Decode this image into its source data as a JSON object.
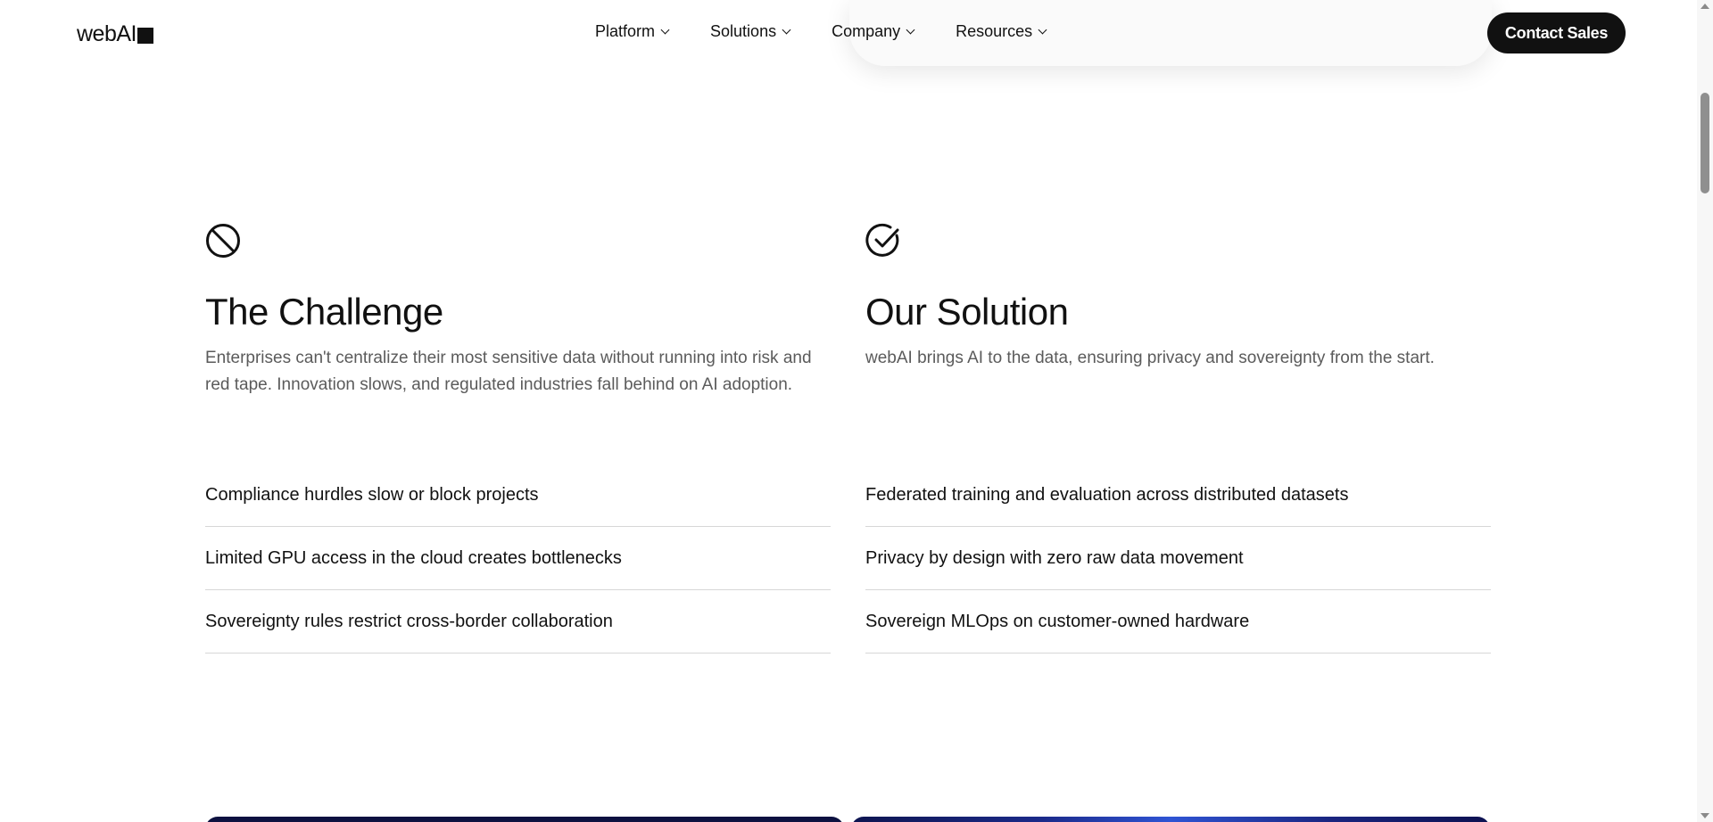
{
  "header": {
    "logo_text": "webAI",
    "nav": [
      {
        "label": "Platform"
      },
      {
        "label": "Solutions"
      },
      {
        "label": "Company"
      },
      {
        "label": "Resources"
      }
    ],
    "cta_label": "Contact Sales"
  },
  "challenge": {
    "icon": "prohibited-icon",
    "title": "The Challenge",
    "description": "Enterprises can't centralize their most sensitive data without running into risk and red tape. Innovation slows, and regulated industries fall behind on AI adoption.",
    "items": [
      "Compliance hurdles slow or block projects",
      "Limited GPU access in the cloud creates bottlenecks",
      "Sovereignty rules restrict cross-border collaboration"
    ]
  },
  "solution": {
    "icon": "check-circle-icon",
    "title": "Our Solution",
    "description": "webAI brings AI to the data, ensuring privacy and sovereignty from the start.",
    "items": [
      "Federated training and evaluation across distributed datasets",
      "Privacy by design with zero raw data movement",
      "Sovereign MLOps on customer-owned hardware"
    ]
  },
  "colors": {
    "text": "#111111",
    "muted_text": "#5b5b5b",
    "divider": "#d7d7d7",
    "cta_background": "#111111"
  }
}
